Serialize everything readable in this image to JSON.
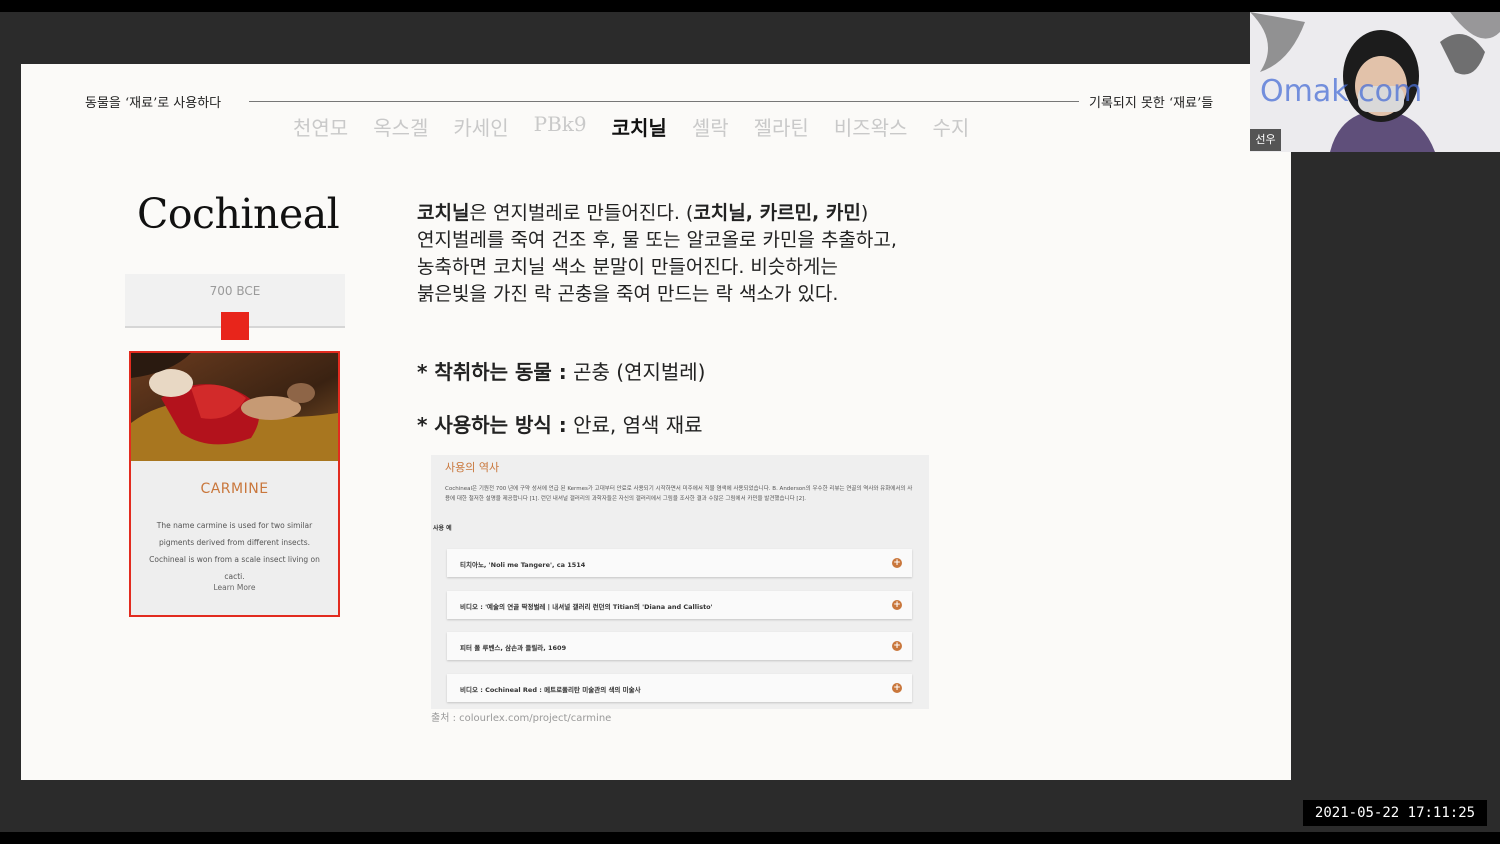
{
  "slide": {
    "header_left": "동물을 ‘재료’로 사용하다",
    "header_right": "기록되지 못한 ‘재료’들",
    "tabs": [
      "천연모",
      "옥스겔",
      "카세인",
      "PBk9",
      "코치닐",
      "셸락",
      "젤라틴",
      "비즈왁스",
      "수지"
    ],
    "active_tab": "코치닐",
    "title": "Cochineal",
    "timeline_label": "700 BCE",
    "card": {
      "title": "CARMINE",
      "description": "The name carmine is used for two similar pigments derived from different insects. Cochineal is won from a scale insect living on cacti.",
      "link": "Learn More"
    },
    "body": {
      "line1_bold": "코치닐",
      "line1_rest": "은 연지벌레로 만들어진다. (",
      "line1_names": "코치닐, 카르민, 카민",
      "line1_end": ")",
      "line2": "연지벌레를 죽여 건조 후, 물 또는 알코올로 카민을 추출하고,",
      "line3": "농축하면 코치닐 색소 분말이 만들어진다. 비슷하게는",
      "line4": "붉은빛을 가진 락 곤충을 죽여 만드는 락 색소가 있다."
    },
    "bullet1": {
      "label": "* 착취하는 동물 :",
      "value": " 곤충 (연지벌레)"
    },
    "bullet2": {
      "label": "* 사용하는 방식 :",
      "value": " 안료, 염색 재료"
    },
    "screenshot": {
      "title": "사용의 역사",
      "description": "Cochineal은 기원전 700 년에 구약 성서에 언급 된 Kermes가 고대부터 안료로 사용되기 시작하면서 미주에서 직물 염색에 사용되었습니다. B. Anderson의 우수한 리뷰는 연골의 역사와 유화에서의 사용에 대한 철저한 설명을 제공합니다 [1]. 런던 내셔널 갤러리의 과학자들은 자신의 갤러리에서 그림을 조사한 결과 수많은 그림에서 카민을 발견했습니다 [2].",
      "subheading": "사용 예",
      "items": [
        "티치아노, 'Noli me Tangere', ca 1514",
        "비디오 : '예술의 연골 딱정벌레 | 내셔널 갤러리 런던의 Titian의 'Diana and Callisto'",
        "피터 폴 루벤스, 삼손과 들릴라, 1609",
        "비디오 : Cochineal Red : 메트로폴리탄 미술관의 색의 미술사"
      ]
    },
    "source": "출처 : colourlex.com/project/carmine"
  },
  "webcam": {
    "name": "선우",
    "overlay_text": "Omak com"
  },
  "timestamp": "2021-05-22 17:11:25",
  "colors": {
    "accent_red": "#e22b1f",
    "accent_orange": "#c9773c"
  }
}
